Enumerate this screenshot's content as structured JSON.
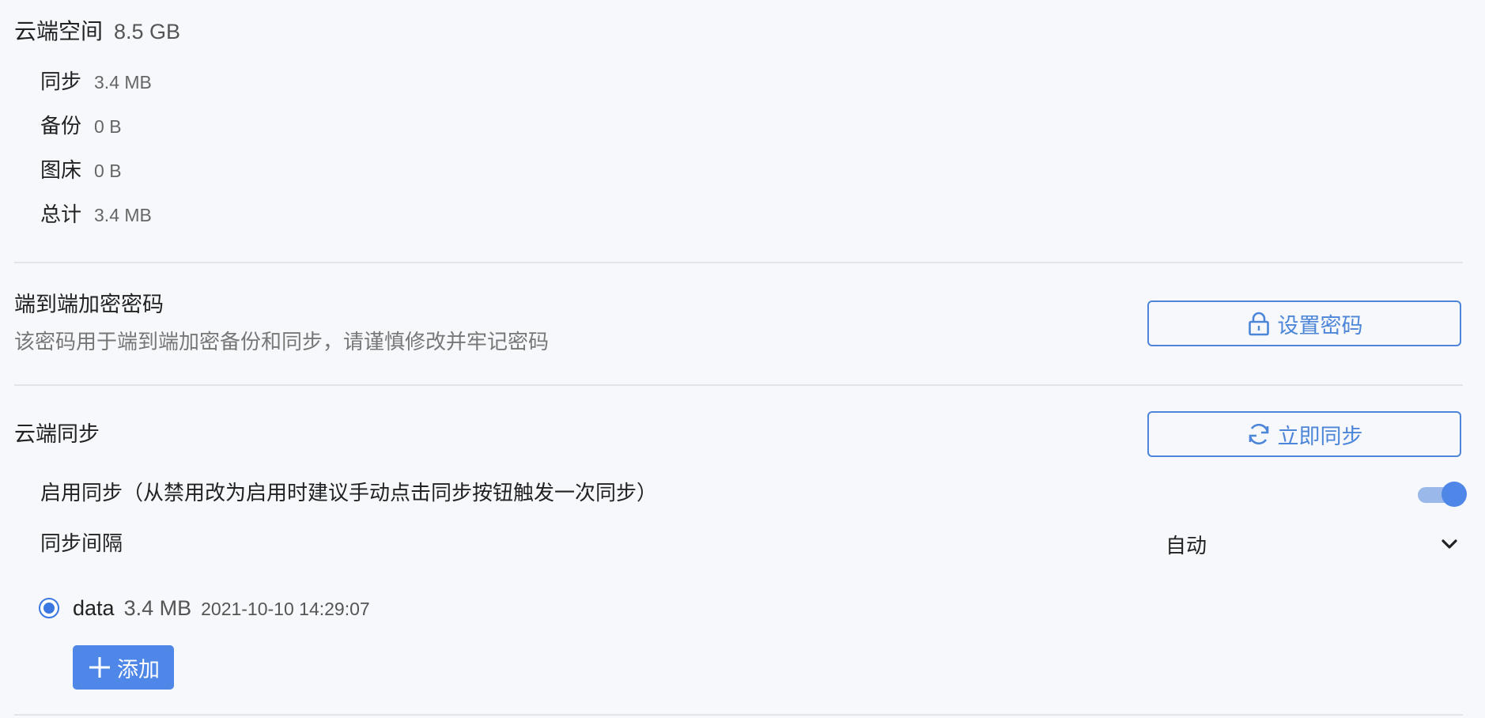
{
  "storage": {
    "title": "云端空间",
    "total": "8.5 GB",
    "rows": [
      {
        "label": "同步",
        "value": "3.4 MB"
      },
      {
        "label": "备份",
        "value": "0 B"
      },
      {
        "label": "图床",
        "value": "0 B"
      },
      {
        "label": "总计",
        "value": "3.4 MB"
      }
    ]
  },
  "encryption": {
    "title": "端到端加密密码",
    "description": "该密码用于端到端加密备份和同步，请谨慎修改并牢记密码",
    "button_label": "设置密码",
    "button_icon": "lock-icon"
  },
  "sync": {
    "title": "云端同步",
    "button_label": "立即同步",
    "button_icon": "sync-icon",
    "enable_label": "启用同步（从禁用改为启用时建议手动点击同步按钮触发一次同步）",
    "enabled": true,
    "interval_label": "同步间隔",
    "interval_value": "自动"
  },
  "data_entries": [
    {
      "name": "data",
      "size": "3.4 MB",
      "time": "2021-10-10 14:29:07",
      "selected": true
    }
  ],
  "add_button": {
    "label": "添加",
    "icon": "plus-icon"
  },
  "colors": {
    "accent": "#4f87e8",
    "outline": "#4d86d9",
    "background": "#f6f8fb",
    "divider": "#e2e4e7"
  }
}
